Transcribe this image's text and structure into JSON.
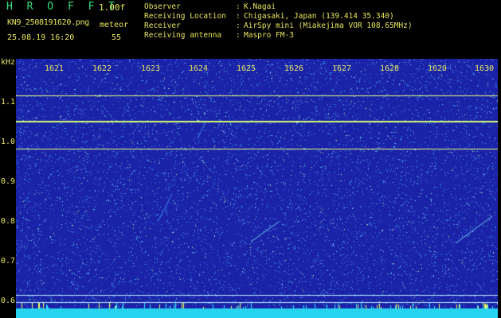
{
  "header": {
    "title": "H R O F F T",
    "version": "1.00f",
    "filename": "KN9_2508191620.png",
    "meteor_label": "meteor",
    "datetime": "25.08.19 16:20",
    "meteor_count": "55"
  },
  "info": [
    {
      "label": "Observer",
      "value": "K.Nagai"
    },
    {
      "label": "Receiving Location",
      "value": "Chigasaki, Japan (139.414 35.340)"
    },
    {
      "label": "Receiver",
      "value": "AirSpy mini (Miakejima VOR 108.65MHz)"
    },
    {
      "label": "Receiving antenna",
      "value": "Maspro FM-3"
    }
  ],
  "spectrogram": {
    "y_unit": "kHz",
    "y_ticks": [
      "1.1",
      "1.0",
      "0.9",
      "0.8",
      "0.7",
      "0.6"
    ],
    "x_ticks": [
      "1621",
      "1622",
      "1623",
      "1624",
      "1625",
      "1626",
      "1627",
      "1628",
      "1629",
      "1630"
    ],
    "colors": {
      "background": "#1a22a8",
      "noise": "#3a7ae0",
      "line": "#e8ff80",
      "bottom_band": "#27d4f0"
    }
  }
}
